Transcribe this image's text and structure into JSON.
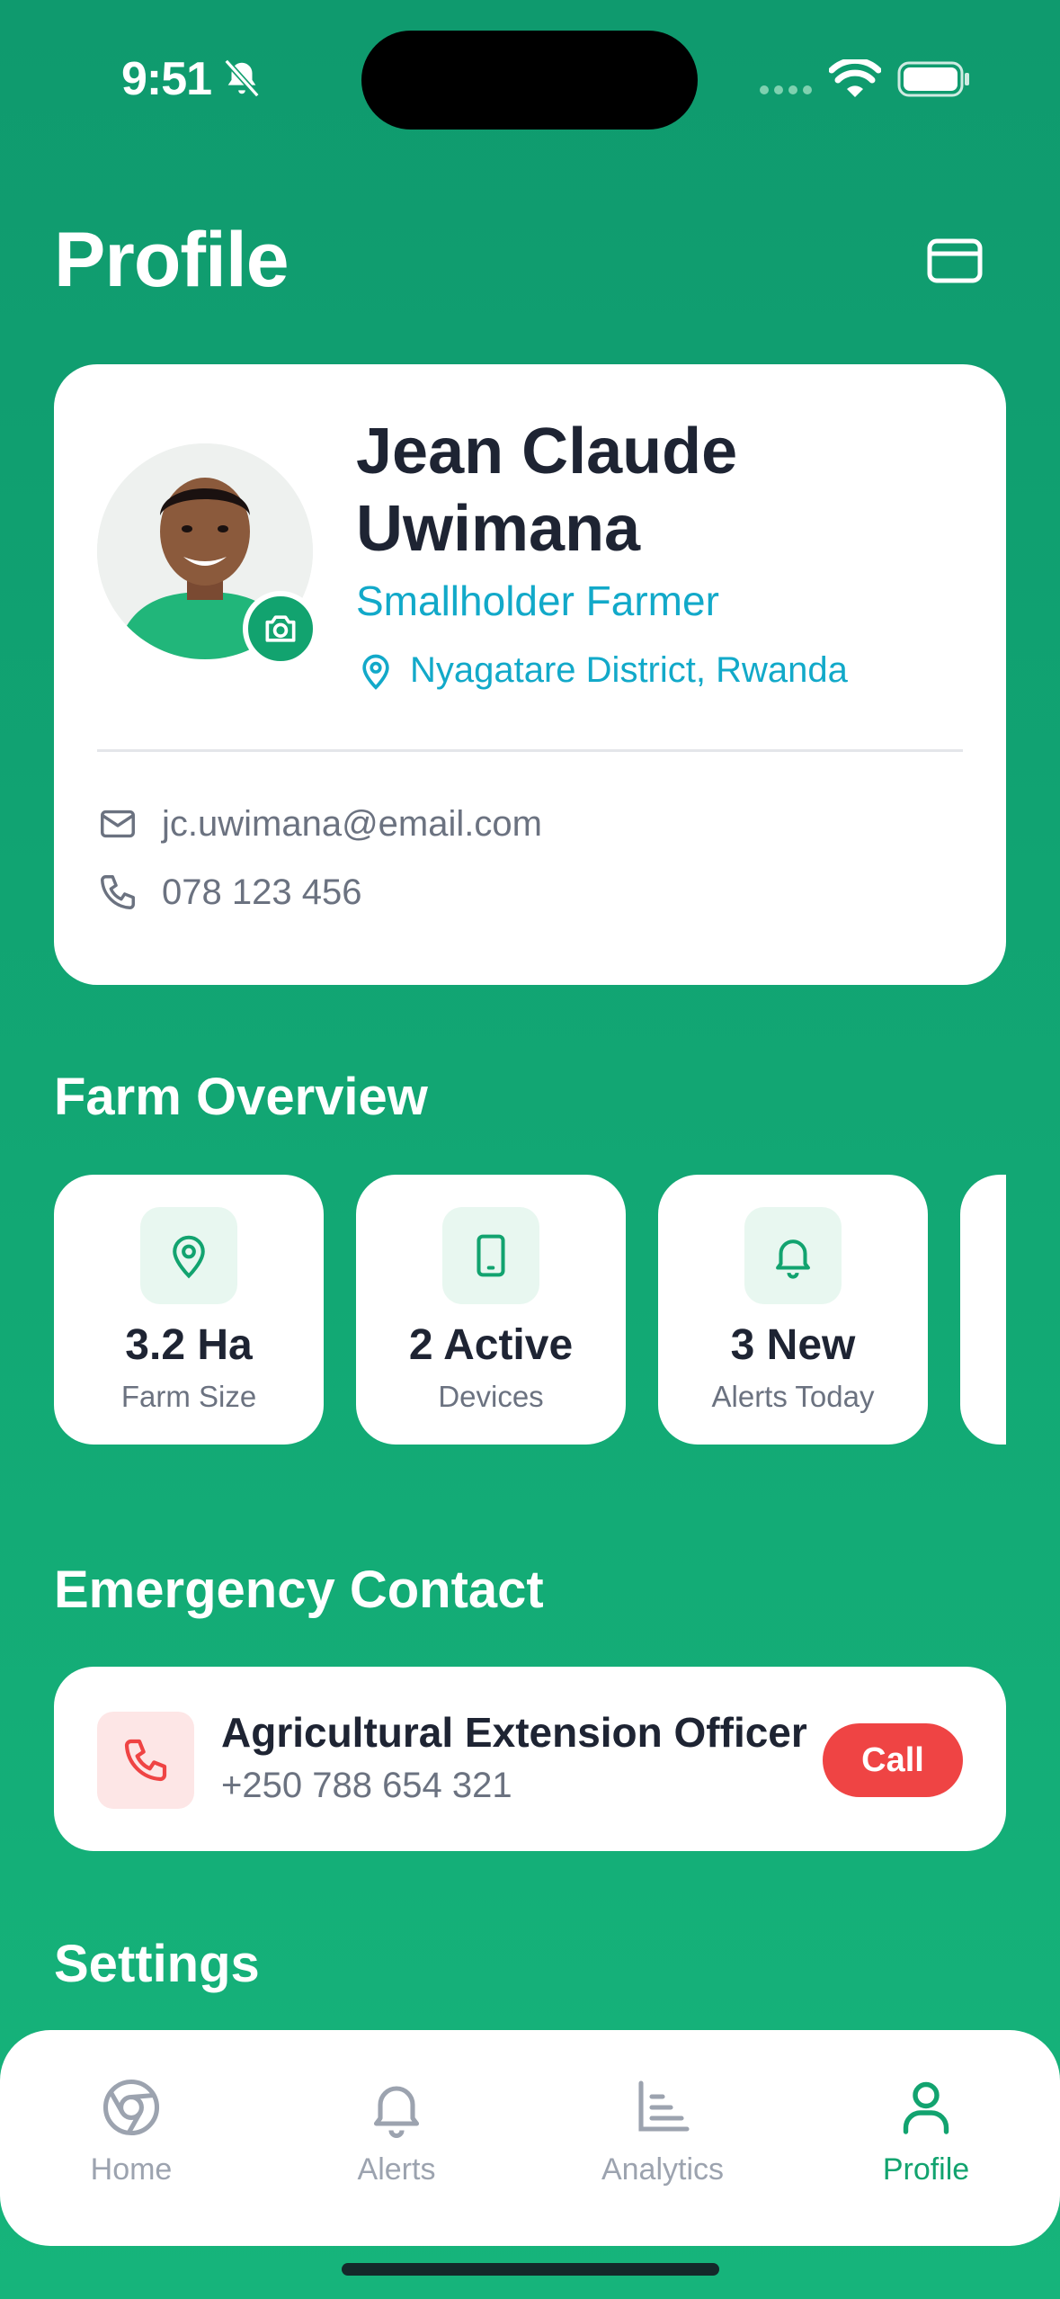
{
  "status_bar": {
    "time": "9:51"
  },
  "header": {
    "title": "Profile"
  },
  "profile": {
    "name": "Jean Claude Uwimana",
    "role": "Smallholder Farmer",
    "location": "Nyagatare District, Rwanda",
    "email": "jc.uwimana@email.com",
    "phone": "078 123 456"
  },
  "farm_overview": {
    "title": "Farm Overview",
    "stats": [
      {
        "icon": "map-pin-icon",
        "value": "3.2 Ha",
        "label": "Farm Size"
      },
      {
        "icon": "device-icon",
        "value": "2 Active",
        "label": "Devices"
      },
      {
        "icon": "bell-icon",
        "value": "3 New",
        "label": "Alerts Today"
      }
    ]
  },
  "emergency": {
    "title": "Emergency Contact",
    "name": "Agricultural Extension Officer",
    "phone": "+250 788 654 321",
    "call_label": "Call"
  },
  "settings": {
    "title": "Settings"
  },
  "tabs": [
    {
      "label": "Home",
      "icon": "home-icon",
      "active": false
    },
    {
      "label": "Alerts",
      "icon": "bell-icon",
      "active": false
    },
    {
      "label": "Analytics",
      "icon": "chart-icon",
      "active": false
    },
    {
      "label": "Profile",
      "icon": "user-icon",
      "active": true
    }
  ],
  "colors": {
    "brand_green": "#12a36f",
    "accent_cyan": "#12a9c9",
    "danger_red": "#ef4444"
  }
}
